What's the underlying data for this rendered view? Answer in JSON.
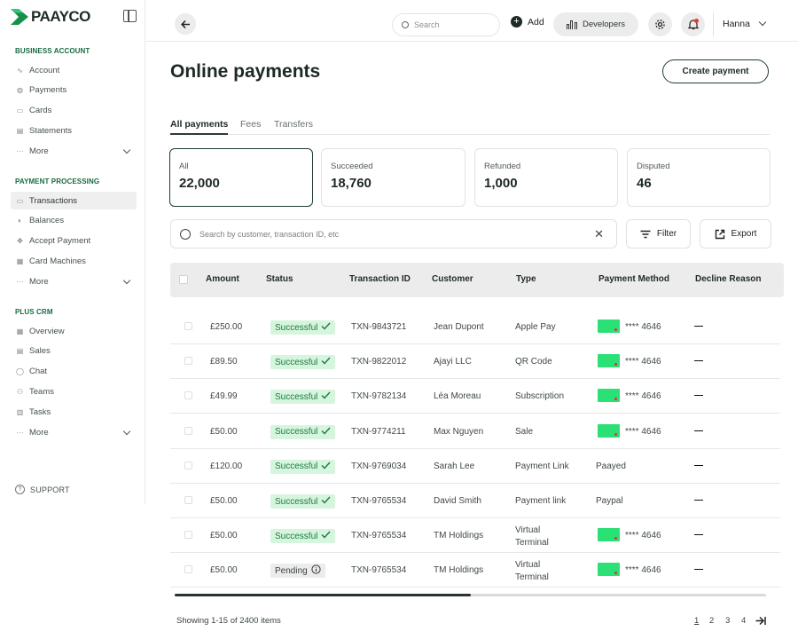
{
  "brand": {
    "name": "PAAYCO",
    "color": "#1a8f4b"
  },
  "sidebar": {
    "sections": [
      {
        "title": "BUSINESS ACCOUNT",
        "items": [
          {
            "label": "Account",
            "icon": "chart-icon"
          },
          {
            "label": "Payments",
            "icon": "globe-icon"
          },
          {
            "label": "Cards",
            "icon": "card-icon"
          },
          {
            "label": "Statements",
            "icon": "document-icon"
          },
          {
            "label": "More",
            "icon": "dots-icon"
          }
        ]
      },
      {
        "title": "PAYMENT PROCESSING",
        "items": [
          {
            "label": "Transactions",
            "icon": "transactions-icon"
          },
          {
            "label": "Balances",
            "icon": "balance-icon"
          },
          {
            "label": "Accept Payment",
            "icon": "crosshair-icon"
          },
          {
            "label": "Card Machines",
            "icon": "card-machine-icon"
          },
          {
            "label": "More",
            "icon": "dots-icon"
          }
        ]
      },
      {
        "title": "PLUS CRM",
        "items": [
          {
            "label": "Overview",
            "icon": "grid-icon"
          },
          {
            "label": "Sales",
            "icon": "sales-icon"
          },
          {
            "label": "Chat",
            "icon": "chat-icon"
          },
          {
            "label": "Teams",
            "icon": "teams-icon"
          },
          {
            "label": "Tasks",
            "icon": "tasks-icon"
          },
          {
            "label": "More",
            "icon": "dots-icon"
          }
        ]
      }
    ],
    "active_item": "Transactions",
    "support": "SUPPORT"
  },
  "topbar": {
    "search_placeholder": "Search",
    "add_label": "Add",
    "developers_label": "Developers",
    "user_name": "Hanna"
  },
  "main": {
    "title": "Online payments",
    "create_button": "Create payment",
    "tabs": [
      "All payments",
      "Fees",
      "Transfers"
    ],
    "active_tab": "All payments",
    "summary_cards": [
      {
        "label": "All",
        "value": "22,000"
      },
      {
        "label": "Succeeded",
        "value": "18,760"
      },
      {
        "label": "Refunded",
        "value": "1,000"
      },
      {
        "label": "Disputed",
        "value": "46"
      }
    ],
    "search_placeholder": "Search by customer, transaction ID, etc",
    "filter_label": "Filter",
    "export_label": "Export"
  },
  "table": {
    "headers": [
      "Amount",
      "Status",
      "Transaction ID",
      "Customer",
      "Type",
      "Payment Method",
      "Decline Reason"
    ],
    "rows": [
      {
        "amount": "£250.00",
        "status": "Successful",
        "txn": "TXN-9843721",
        "customer": "Jean Dupont",
        "type": "Apple Pay",
        "method": "**** 4646",
        "card": true,
        "decline": "—"
      },
      {
        "amount": "£89.50",
        "status": "Successful",
        "txn": "TXN-9822012",
        "customer": "Ajayi LLC",
        "type": "QR Code",
        "method": "**** 4646",
        "card": true,
        "decline": "—"
      },
      {
        "amount": "£49.99",
        "status": "Successful",
        "txn": "TXN-9782134",
        "customer": "Léa Moreau",
        "type": "Subscription",
        "method": "**** 4646",
        "card": true,
        "decline": "—"
      },
      {
        "amount": "£50.00",
        "status": "Successful",
        "txn": "TXN-9774211",
        "customer": "Max Nguyen",
        "type": "Sale",
        "method": "**** 4646",
        "card": true,
        "decline": "—"
      },
      {
        "amount": "£120.00",
        "status": "Successful",
        "txn": "TXN-9769034",
        "customer": "Sarah Lee",
        "type": "Payment Link",
        "method": "Paayed",
        "card": false,
        "decline": "—"
      },
      {
        "amount": "£50.00",
        "status": "Successful",
        "txn": "TXN-9765534",
        "customer": "David Smith",
        "type": "Payment link",
        "method": "Paypal",
        "card": false,
        "decline": "—"
      },
      {
        "amount": "£50.00",
        "status": "Successful",
        "txn": "TXN-9765534",
        "customer": "TM Holdings",
        "type": "Virtual Terminal",
        "method": "**** 4646",
        "card": true,
        "decline": "—"
      },
      {
        "amount": "£50.00",
        "status": "Pending",
        "txn": "TXN-9765534",
        "customer": "TM Holdings",
        "type": "Virtual Terminal",
        "method": "**** 4646",
        "card": true,
        "decline": "—"
      }
    ]
  },
  "footer": {
    "showing": "Showing 1-15 of 2400 items",
    "pages": [
      "1",
      "2",
      "3",
      "4"
    ],
    "current_page": "1",
    "horizontal_scroll_fraction": 0.5
  },
  "colors": {
    "success_bg": "#d6f5de",
    "success_text": "#1e7a3c",
    "card_green": "#2be074",
    "notification": "#e23b2f"
  }
}
